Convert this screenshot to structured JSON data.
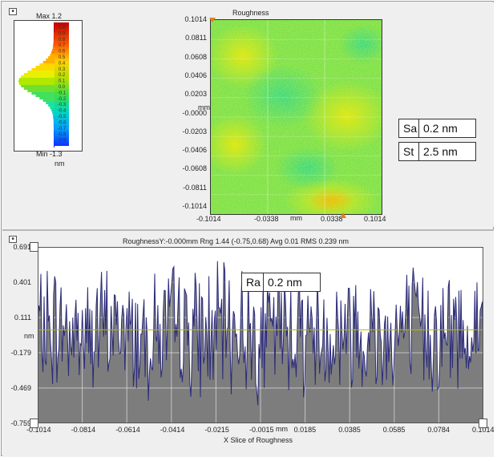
{
  "top_panel": {
    "histogram": {
      "max_label": "Max 1.2",
      "min_label": "Min -1.3",
      "unit": "nm",
      "scale_ticks": [
        "1.0",
        "0.9",
        "0.8",
        "0.7",
        "0.6",
        "0.5",
        "0.4",
        "0.3",
        "0.2",
        "0.1",
        "0.0",
        "-0.1",
        "-0.2",
        "-0.3",
        "-0.4",
        "-0.5",
        "-0.6",
        "-0.7",
        "-0.8",
        "-0.9"
      ]
    },
    "map": {
      "title": "Roughness",
      "y_ticks": [
        "0.1014",
        "0.0811",
        "0.0608",
        "0.0406",
        "0.0203",
        "-0.0000",
        "-0.0203",
        "-0.0406",
        "-0.0608",
        "-0.0811",
        "-0.1014"
      ],
      "y_unit": "mm",
      "x_ticks": [
        "-0.1014",
        "-0.0338",
        "0.0338",
        "0.1014"
      ],
      "x_unit": "mm"
    },
    "params": [
      {
        "name": "Sa",
        "value": "0.2 nm"
      },
      {
        "name": "St",
        "value": "2.5 nm"
      }
    ]
  },
  "bottom_panel": {
    "header": "RoughnessY:-0.000mm  Rng 1.44 (-0.75,0.68) Avg 0.01 RMS 0.239 nm",
    "ra": {
      "name": "Ra",
      "value": "0.2 nm"
    },
    "y_unit": "nm",
    "x_unit": "mm",
    "x_title": "X Slice of Roughness",
    "colors": {
      "fill": "#7d7d7d",
      "line": "#2a2a7a",
      "mean": "#b8b800"
    },
    "chart_data": {
      "type": "line",
      "title": "X Slice of Roughness",
      "xlabel": "mm",
      "ylabel": "nm",
      "xlim": [
        -0.1014,
        0.1014
      ],
      "ylim": [
        -0.759,
        0.691
      ],
      "y_ticks": [
        "0.691",
        "0.401",
        "0.111",
        "-0.179",
        "-0.469",
        "-0.759"
      ],
      "x_ticks": [
        "-0.1014",
        "-0.0814",
        "-0.0614",
        "-0.0414",
        "-0.0215",
        "-0.0015",
        "0.0185",
        "0.0385",
        "0.0585",
        "0.0784",
        "0.1014"
      ],
      "mean": 0.01,
      "range": [
        -0.75,
        0.68
      ]
    }
  }
}
